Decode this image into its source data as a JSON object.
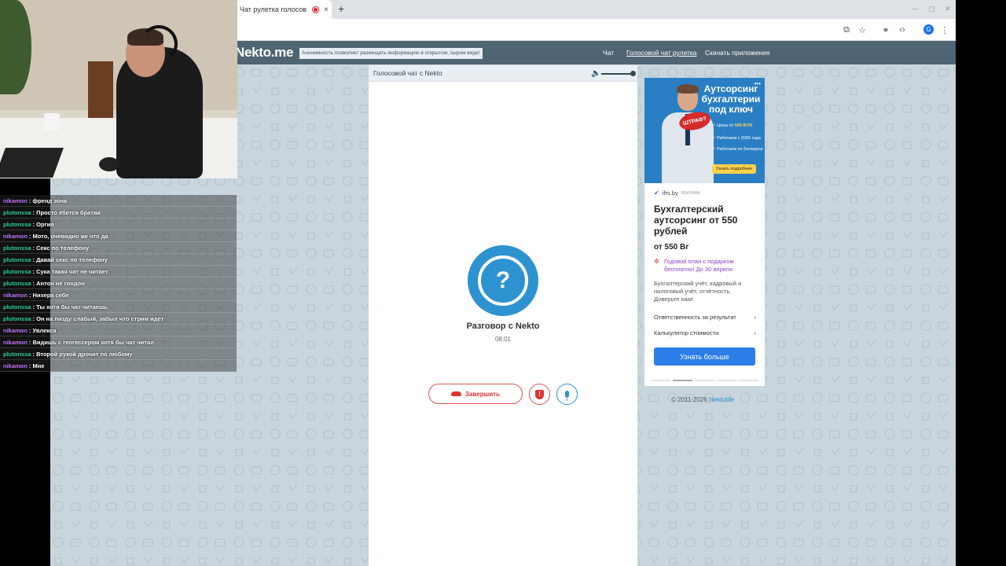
{
  "browser": {
    "tab_title": "Чат рулетка голосов",
    "tab_close": "×",
    "new_tab": "+",
    "win_min": "—",
    "win_max": "▢",
    "win_close": "✕",
    "profile_letter": "G"
  },
  "site": {
    "logo": "Nekto.me",
    "anon_note": "Анонимность позволяет размещать информацию в открытом, сыром виде!",
    "nav": [
      "Чат",
      "Голосовой чат рулетка",
      "Скачать приложения"
    ]
  },
  "panel": {
    "header": "Голосовой чат с Nekto",
    "avatar_glyph": "?",
    "conv_title": "Разговор с Nekto",
    "conv_time": "08:01",
    "end_label": "Завершить",
    "shield_glyph": "!"
  },
  "ad": {
    "headline": "Аутсорсинг бухгалтерии под ключ",
    "stamp": "ШТРАФ?",
    "point1_pre": "Цены от ",
    "point1_price": "550 BYN",
    "point2": "Работаем с 2005 года",
    "point3": "Работаем по Беларуси",
    "cta_small": "Узнать подробнее",
    "dots": "•••",
    "source": "ifrs.by",
    "source_tag": "РЕКЛАМА",
    "title": "Бухгалтерский аутсорсинг от 550 рублей",
    "price": "от 550 Br",
    "promo": "Годовой план с подарком бесплатно! До 30 апреля",
    "desc": "Бухгалтерский учёт, кадровый и налоговый учёт, отчётность. Доверьте нам!",
    "link1": "Ответственность за результат",
    "link2": "Калькулятор стоимости",
    "button": "Узнать больше"
  },
  "footer": {
    "copyright": "© 2011-2026 ",
    "copyright_link": "NektoMe"
  },
  "stream_chat": [
    {
      "user": "nikamon",
      "text": " : френд зона"
    },
    {
      "user": "plutonssa",
      "text": " : Просто ебется братва"
    },
    {
      "user": "plutonssa",
      "text": " : Оргия"
    },
    {
      "user": "nikamon",
      "text": " : Мото, очевидно же что да"
    },
    {
      "user": "plutonssa",
      "text": " : Секс по телефону"
    },
    {
      "user": "plutonssa",
      "text": " : Давай секс по телефону"
    },
    {
      "user": "plutonssa",
      "text": " : Сука такая чат не читает"
    },
    {
      "user": "plutonssa",
      "text": " : Антон не гондон"
    },
    {
      "user": "nikamon",
      "text": " : Нихера себе"
    },
    {
      "user": "plutonssa",
      "text": " : Ты хотя бы чат читаешь"
    },
    {
      "user": "plutonssa",
      "text": " : Он на пизду слабый, забыл что стрим идет"
    },
    {
      "user": "nikamon",
      "text": " : Увлекся"
    },
    {
      "user": "nikamon",
      "text": " : Видишь с геогессером хотя бы чат читал"
    },
    {
      "user": "plutonssa",
      "text": " : Второй рукой дрочит по любому"
    },
    {
      "user": "nikamon",
      "text": " : Мне"
    }
  ]
}
